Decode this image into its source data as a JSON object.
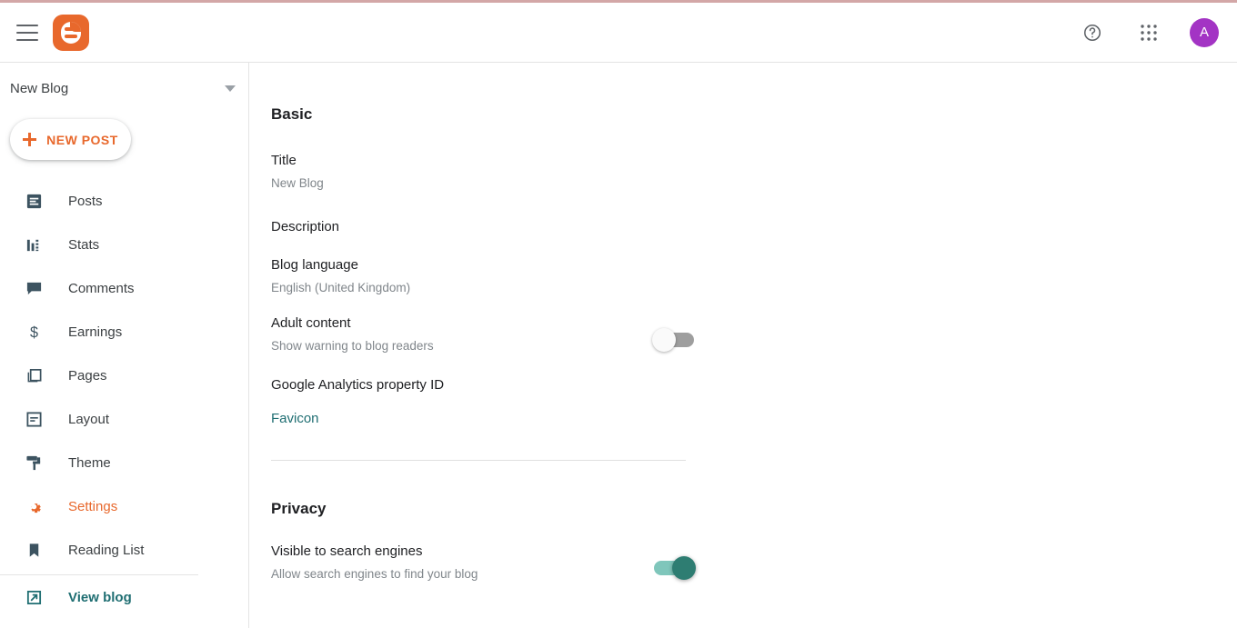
{
  "header": {
    "menu_icon": "hamburger-menu-icon",
    "logo_icon": "blogger-logo-icon",
    "help_icon": "help-circle-icon",
    "apps_icon": "apps-grid-icon",
    "avatar_initial": "A",
    "avatar_color": "#a334c4"
  },
  "sidebar": {
    "blog_name": "New Blog",
    "new_post_label": "NEW POST",
    "items": [
      {
        "label": "Posts",
        "icon": "posts-icon"
      },
      {
        "label": "Stats",
        "icon": "stats-bar-chart-icon"
      },
      {
        "label": "Comments",
        "icon": "comment-bubble-icon"
      },
      {
        "label": "Earnings",
        "icon": "dollar-sign-icon"
      },
      {
        "label": "Pages",
        "icon": "pages-stack-icon"
      },
      {
        "label": "Layout",
        "icon": "layout-icon"
      },
      {
        "label": "Theme",
        "icon": "paint-roller-icon"
      },
      {
        "label": "Settings",
        "icon": "gear-icon"
      },
      {
        "label": "Reading List",
        "icon": "bookmark-icon"
      }
    ],
    "view_blog_label": "View blog",
    "view_blog_icon": "external-link-icon",
    "accent_color": "#e8682c",
    "link_color": "#1f6e72"
  },
  "main": {
    "basic": {
      "title": "Basic",
      "rows": [
        {
          "label": "Title",
          "value": "New Blog"
        },
        {
          "label": "Description",
          "value": ""
        },
        {
          "label": "Blog language",
          "value": "English (United Kingdom)"
        },
        {
          "label": "Adult content",
          "value": "Show warning to blog readers"
        },
        {
          "label": "Google Analytics property ID",
          "value": ""
        }
      ],
      "favicon_label": "Favicon",
      "adult_content_toggle": "off"
    },
    "privacy": {
      "title": "Privacy",
      "rows": [
        {
          "label": "Visible to search engines",
          "value": "Allow search engines to find your blog"
        }
      ],
      "search_engines_toggle": "on"
    }
  }
}
